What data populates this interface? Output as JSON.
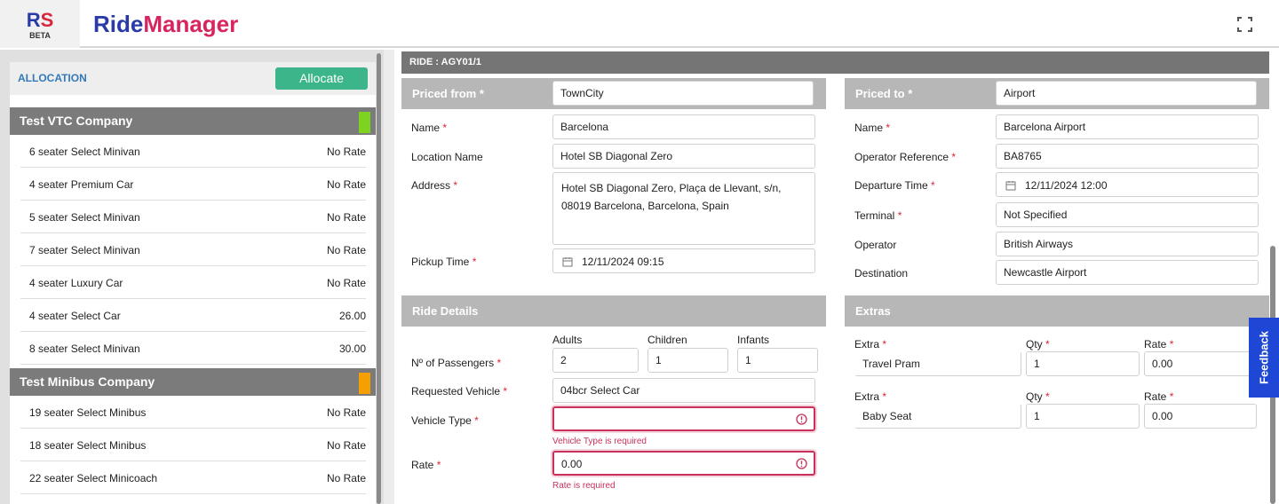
{
  "header": {
    "logo_r": "R",
    "logo_s": "S",
    "logo_badge": "BETA",
    "brand_part1": "Ride",
    "brand_part2": "Manager"
  },
  "allocation": {
    "title": "ALLOCATION",
    "allocate_label": "Allocate"
  },
  "companies": [
    {
      "name": "Test VTC Company",
      "swatch_color": "#7ed321",
      "vehicles": [
        {
          "name": "6 seater Select Minivan",
          "rate": "No Rate"
        },
        {
          "name": "4 seater Premium Car",
          "rate": "No Rate"
        },
        {
          "name": "5 seater Select Minivan",
          "rate": "No Rate"
        },
        {
          "name": "7 seater Select Minivan",
          "rate": "No Rate"
        },
        {
          "name": "4 seater Luxury Car",
          "rate": "No Rate"
        },
        {
          "name": "4 seater Select Car",
          "rate": "26.00"
        },
        {
          "name": "8 seater Select Minivan",
          "rate": "30.00"
        }
      ]
    },
    {
      "name": "Test Minibus Company",
      "swatch_color": "#f5a000",
      "vehicles": [
        {
          "name": "19 seater Select Minibus",
          "rate": "No Rate"
        },
        {
          "name": "18 seater Select Minibus",
          "rate": "No Rate"
        },
        {
          "name": "22 seater Select Minicoach",
          "rate": "No Rate"
        }
      ]
    }
  ],
  "ride": {
    "title": "RIDE : AGY01/1"
  },
  "priced_from": {
    "label": "Priced from",
    "value": "TownCity",
    "name_label": "Name",
    "name_value": "Barcelona",
    "location_label": "Location Name",
    "location_value": "Hotel SB Diagonal Zero",
    "address_label": "Address",
    "address_value": "Hotel SB Diagonal Zero, Plaça de Llevant, s/n, 08019 Barcelona, Barcelona, Spain",
    "pickup_label": "Pickup Time",
    "pickup_value": "12/11/2024 09:15"
  },
  "priced_to": {
    "label": "Priced to",
    "value": "Airport",
    "name_label": "Name",
    "name_value": "Barcelona Airport",
    "opref_label": "Operator Reference",
    "opref_value": "BA8765",
    "departure_label": "Departure Time",
    "departure_value": "12/11/2024 12:00",
    "terminal_label": "Terminal",
    "terminal_value": "Not Specified",
    "operator_label": "Operator",
    "operator_value": "British Airways",
    "destination_label": "Destination",
    "destination_value": "Newcastle Airport"
  },
  "ride_details": {
    "title": "Ride Details",
    "adults_label": "Adults",
    "children_label": "Children",
    "infants_label": "Infants",
    "passengers_label": "Nº of Passengers",
    "adults_value": "2",
    "children_value": "1",
    "infants_value": "1",
    "requested_label": "Requested Vehicle",
    "requested_value": "04bcr Select Car",
    "vehicle_type_label": "Vehicle Type",
    "vehicle_type_value": "",
    "vehicle_type_error": "Vehicle Type is required",
    "rate_label": "Rate",
    "rate_value": "0.00",
    "rate_error": "Rate is required"
  },
  "extras": {
    "title": "Extras",
    "extra_label": "Extra",
    "qty_label": "Qty",
    "rate_label": "Rate",
    "items": [
      {
        "name": "Travel Pram",
        "qty": "1",
        "rate": "0.00"
      },
      {
        "name": "Baby Seat",
        "qty": "1",
        "rate": "0.00"
      }
    ]
  },
  "required_marker": "*",
  "feedback_label": "Feedback",
  "colors": {
    "allocate_button": "#3db58a",
    "error": "#c8325a",
    "brand_blue": "#2a3aa6",
    "brand_pink": "#d7265f",
    "feedback": "#1e47d6"
  }
}
